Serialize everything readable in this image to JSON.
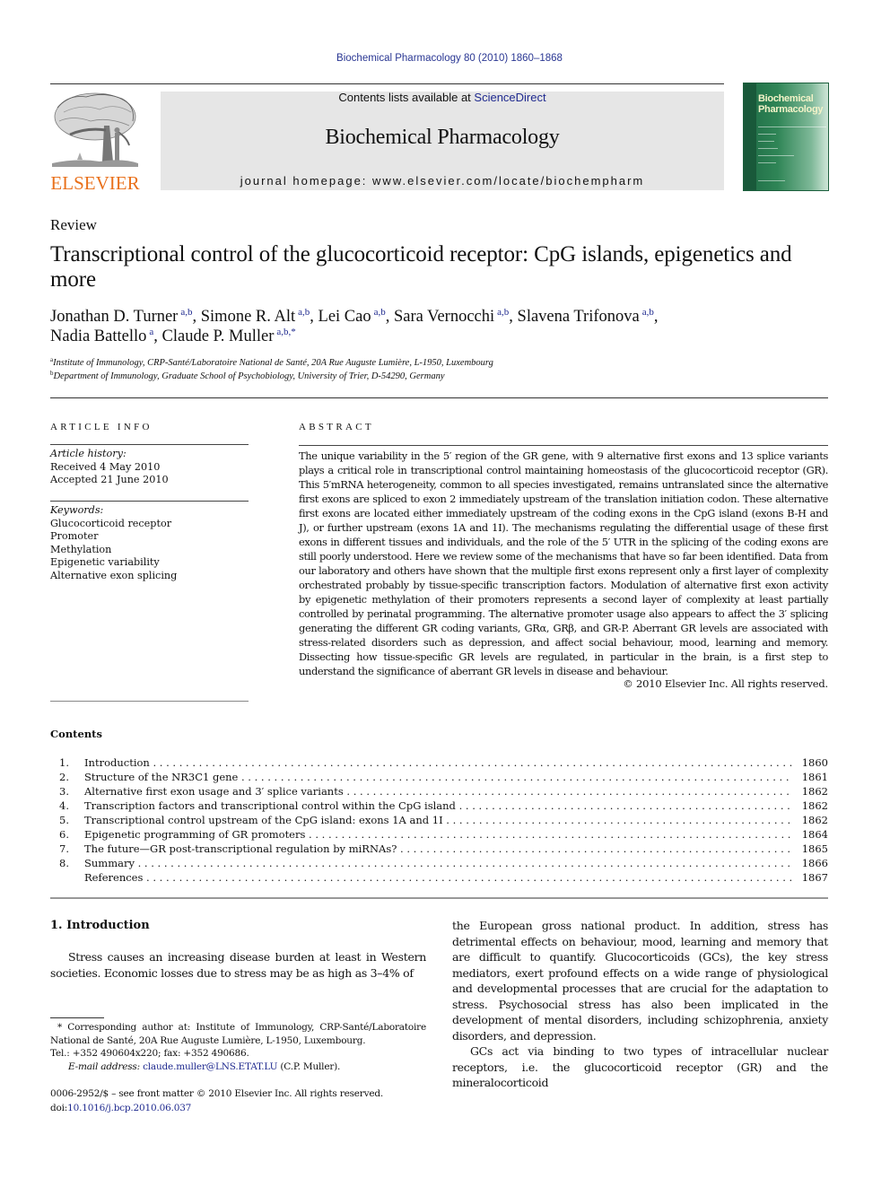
{
  "header": {
    "journal_ref": "Biochemical Pharmacology 80 (2010) 1860–1868",
    "contents_prefix": "Contents lists available at ",
    "sciencedirect_link": "ScienceDirect",
    "journal_name": "Biochemical Pharmacology",
    "homepage_prefix": "journal homepage: ",
    "homepage_url": "www.elsevier.com/locate/biochempharm",
    "publisher_logo": "ELSEVIER",
    "cover_title_line1": "Biochemical",
    "cover_title_line2": "Pharmacology"
  },
  "article": {
    "section_type": "Review",
    "title": "Transcriptional control of the glucocorticoid receptor: CpG islands, epigenetics and more",
    "authors": [
      {
        "name": "Jonathan D. Turner",
        "sup": "a,b",
        "sep": ", "
      },
      {
        "name": "Simone R. Alt",
        "sup": "a,b",
        "sep": ", "
      },
      {
        "name": "Lei Cao",
        "sup": "a,b",
        "sep": ", "
      },
      {
        "name": "Sara Vernocchi",
        "sup": "a,b",
        "sep": ", "
      },
      {
        "name": "Slavena Trifonova",
        "sup": "a,b",
        "sep": ","
      },
      {
        "name": "Nadia Battello",
        "sup": "a",
        "sep": ", "
      },
      {
        "name": "Claude P. Muller",
        "sup": "a,b,*",
        "sep": ""
      }
    ],
    "affiliations": [
      {
        "mark": "a",
        "text": "Institute of Immunology, CRP-Santé/Laboratoire National de Santé, 20A Rue Auguste Lumière, L-1950, Luxembourg"
      },
      {
        "mark": "b",
        "text": "Department of Immunology, Graduate School of Psychobiology, University of Trier, D-54290, Germany"
      }
    ]
  },
  "article_info": {
    "heading": "ARTICLE INFO",
    "history_label": "Article history:",
    "received": "Received 4 May 2010",
    "accepted": "Accepted 21 June 2010",
    "keywords_label": "Keywords:",
    "keywords": [
      "Glucocorticoid receptor",
      "Promoter",
      "Methylation",
      "Epigenetic variability",
      "Alternative exon splicing"
    ]
  },
  "abstract": {
    "heading": "ABSTRACT",
    "text": "The unique variability in the 5′ region of the GR gene, with 9 alternative first exons and 13 splice variants plays a critical role in transcriptional control maintaining homeostasis of the glucocorticoid receptor (GR). This 5′mRNA heterogeneity, common to all species investigated, remains untranslated since the alternative first exons are spliced to exon 2 immediately upstream of the translation initiation codon. These alternative first exons are located either immediately upstream of the coding exons in the CpG island (exons B-H and J), or further upstream (exons 1A and 1I). The mechanisms regulating the differential usage of these first exons in different tissues and individuals, and the role of the 5′ UTR in the splicing of the coding exons are still poorly understood. Here we review some of the mechanisms that have so far been identified. Data from our laboratory and others have shown that the multiple first exons represent only a first layer of complexity orchestrated probably by tissue-specific transcription factors. Modulation of alternative first exon activity by epigenetic methylation of their promoters represents a second layer of complexity at least partially controlled by perinatal programming. The alternative promoter usage also appears to affect the 3′ splicing generating the different GR coding variants, GRα, GRβ, and GR-P. Aberrant GR levels are associated with stress-related disorders such as depression, and affect social behaviour, mood, learning and memory. Dissecting how tissue-specific GR levels are regulated, in particular in the brain, is a first step to understand the significance of aberrant GR levels in disease and behaviour.",
    "copyright": "© 2010 Elsevier Inc. All rights reserved."
  },
  "contents": {
    "heading": "Contents",
    "items": [
      {
        "num": "1.",
        "title": "Introduction",
        "page": "1860"
      },
      {
        "num": "2.",
        "title": "Structure of the NR3C1 gene",
        "page": "1861"
      },
      {
        "num": "3.",
        "title": "Alternative first exon usage and 3′ splice variants",
        "page": "1862"
      },
      {
        "num": "4.",
        "title": "Transcription factors and transcriptional control within the CpG island",
        "page": "1862"
      },
      {
        "num": "5.",
        "title": "Transcriptional control upstream of the CpG island: exons 1A and 1I",
        "page": "1862"
      },
      {
        "num": "6.",
        "title": "Epigenetic programming of GR promoters",
        "page": "1864"
      },
      {
        "num": "7.",
        "title": "The future—GR post-transcriptional regulation by miRNAs?",
        "page": "1865"
      },
      {
        "num": "8.",
        "title": "Summary",
        "page": "1866"
      },
      {
        "num": "",
        "title": "References",
        "page": "1867"
      }
    ]
  },
  "introduction": {
    "heading": "1.  Introduction",
    "left_paragraph": "Stress causes an increasing disease burden at least in Western societies. Economic losses due to stress may be as high as 3–4% of",
    "right_paragraph1": "the European gross national product. In addition, stress has detrimental effects on behaviour, mood, learning and memory that are difficult to quantify. Glucocorticoids (GCs), the key stress mediators, exert profound effects on a wide range of physiological and developmental processes that are crucial for the adaptation to stress. Psychosocial stress has also been implicated in the development of mental disorders, including schizophrenia, anxiety disorders, and depression.",
    "right_paragraph2": "GCs act via binding to two types of intracellular nuclear receptors, i.e. the glucocorticoid receptor (GR) and the mineralocorticoid"
  },
  "footnote": {
    "corresponding": "* Corresponding author at: Institute of Immunology, CRP-Santé/Laboratoire National de Santé, 20A Rue Auguste Lumière, L-1950, Luxembourg.",
    "tel": "Tel.: +352 490604x220; fax: +352 490686.",
    "email_label": "E-mail address: ",
    "email": "claude.muller@LNS.ETAT.LU",
    "email_suffix": " (C.P. Muller).",
    "issn": "0006-2952/$ – see front matter © 2010 Elsevier Inc. All rights reserved.",
    "doi_prefix": "doi:",
    "doi": "10.1016/j.bcp.2010.06.037"
  },
  "colors": {
    "link": "#1f2a8f",
    "elsevier_orange": "#e9711c",
    "header_box": "#e6e6e6",
    "cover_green": "#1e6b45"
  }
}
